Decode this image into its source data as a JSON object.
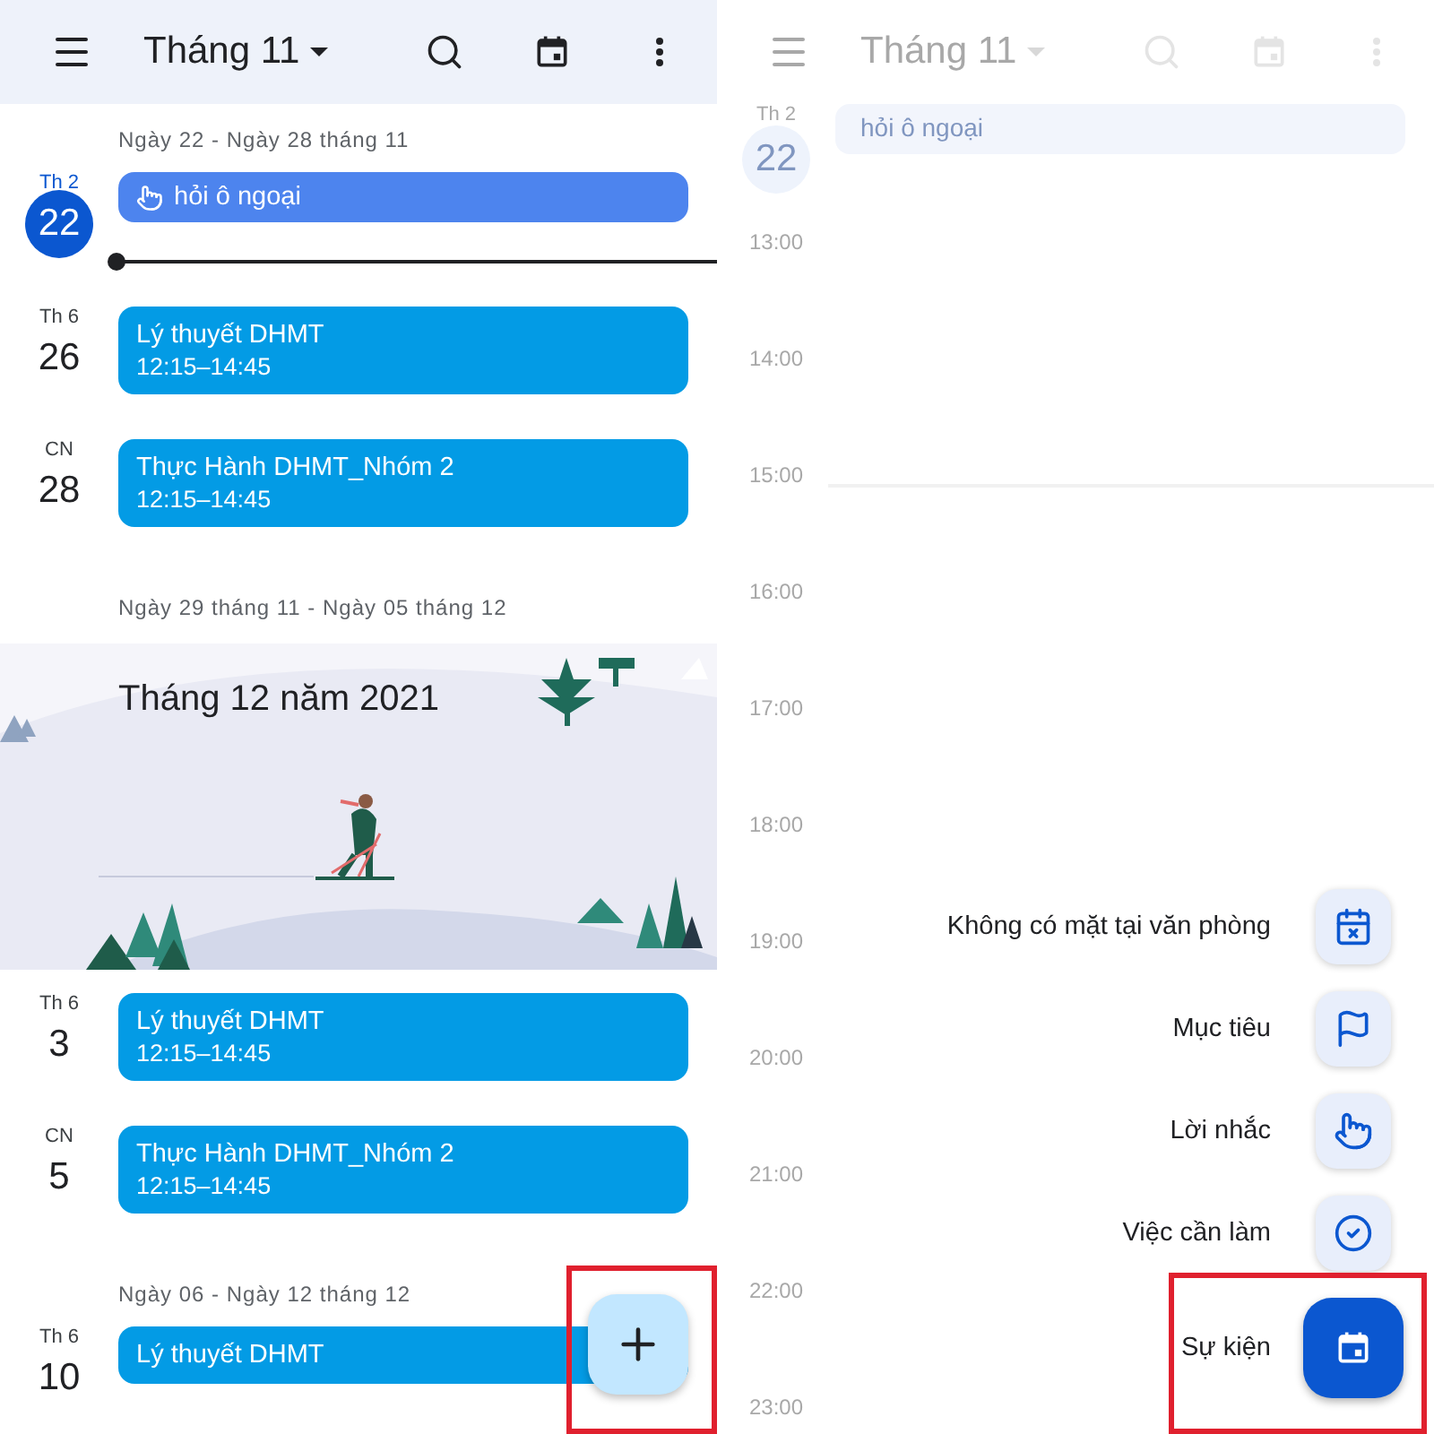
{
  "left": {
    "header": {
      "title": "Tháng 11"
    },
    "agenda": [
      {
        "kind": "week",
        "label": "Ngày 22 - Ngày 28 tháng 11"
      },
      {
        "kind": "day",
        "weekday": "Th 2",
        "date": "22",
        "today": true,
        "events": [
          {
            "kind": "reminder",
            "title": "hỏi ô ngoại"
          }
        ]
      },
      {
        "kind": "now"
      },
      {
        "kind": "day",
        "weekday": "Th 6",
        "date": "26",
        "today": false,
        "events": [
          {
            "kind": "event",
            "title": "Lý thuyết DHMT",
            "time": "12:15–14:45"
          }
        ]
      },
      {
        "kind": "day",
        "weekday": "CN",
        "date": "28",
        "today": false,
        "events": [
          {
            "kind": "event",
            "title": "Thực Hành DHMT_Nhóm 2",
            "time": "12:15–14:45"
          }
        ]
      },
      {
        "kind": "week",
        "label": "Ngày 29 tháng 11 - Ngày 05 tháng 12"
      },
      {
        "kind": "banner",
        "title": "Tháng 12 năm 2021"
      },
      {
        "kind": "day",
        "weekday": "Th 6",
        "date": "3",
        "today": false,
        "events": [
          {
            "kind": "event",
            "title": "Lý thuyết DHMT",
            "time": "12:15–14:45"
          }
        ]
      },
      {
        "kind": "day",
        "weekday": "CN",
        "date": "5",
        "today": false,
        "events": [
          {
            "kind": "event",
            "title": "Thực Hành DHMT_Nhóm 2",
            "time": "12:15–14:45"
          }
        ]
      },
      {
        "kind": "week",
        "label": "Ngày 06 - Ngày 12 tháng 12"
      },
      {
        "kind": "day",
        "weekday": "Th 6",
        "date": "10",
        "today": false,
        "events": [
          {
            "kind": "event",
            "title": "Lý thuyết DHMT"
          }
        ]
      }
    ]
  },
  "right": {
    "header": {
      "title": "Tháng 11"
    },
    "day": {
      "weekday": "Th 2",
      "date": "22"
    },
    "event": {
      "title": "hỏi ô ngoại"
    },
    "hours": [
      "13:00",
      "14:00",
      "15:00",
      "16:00",
      "17:00",
      "18:00",
      "19:00",
      "20:00",
      "21:00",
      "22:00",
      "23:00"
    ],
    "menu": [
      {
        "kind": "out_of_office",
        "label": "Không có mặt tại văn phòng"
      },
      {
        "kind": "goal",
        "label": "Mục tiêu"
      },
      {
        "kind": "reminder",
        "label": "Lời nhắc"
      },
      {
        "kind": "task",
        "label": "Việc cần làm"
      }
    ],
    "primary": {
      "label": "Sự kiện"
    }
  }
}
